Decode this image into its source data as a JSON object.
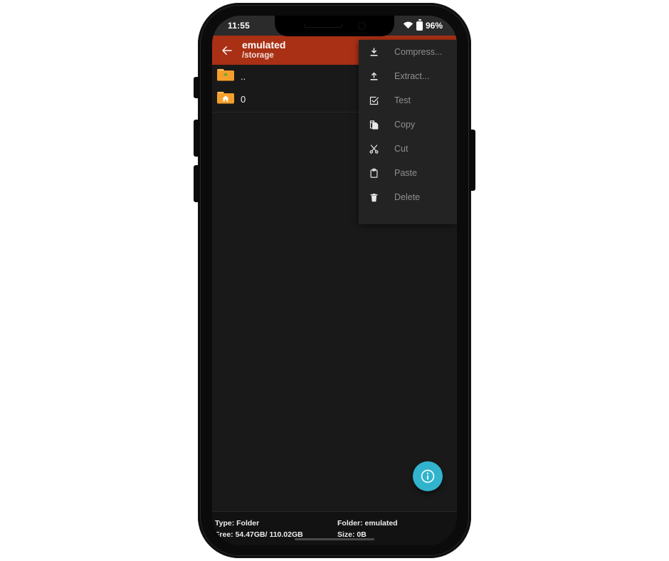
{
  "device": {
    "status_bar": {
      "clock": "11:55",
      "battery_percent": "96%",
      "wifi_icon": "wifi-icon",
      "battery_icon": "battery-icon"
    }
  },
  "app": {
    "header": {
      "back_icon": "back-arrow-icon",
      "title": "emulated",
      "subtitle": "/storage",
      "accent_color": "#a93014"
    },
    "files": [
      {
        "name": "..",
        "icon": "folder-up-icon"
      },
      {
        "name": "0",
        "icon": "folder-home-icon"
      }
    ],
    "context_menu": [
      {
        "label": "Compress...",
        "icon": "download-icon"
      },
      {
        "label": "Extract...",
        "icon": "upload-icon"
      },
      {
        "label": "Test",
        "icon": "checkbox-icon"
      },
      {
        "label": "Copy",
        "icon": "copy-icon"
      },
      {
        "label": "Cut",
        "icon": "scissors-icon"
      },
      {
        "label": "Paste",
        "icon": "clipboard-icon"
      },
      {
        "label": "Delete",
        "icon": "trash-icon"
      }
    ],
    "fab": {
      "icon": "info-icon",
      "color": "#32b3cd"
    },
    "status_bar": {
      "type": "Type: Folder",
      "folder": "Folder: emulated",
      "free": "Free: 54.47GB/ 110.02GB",
      "size": "Size: 0B"
    }
  }
}
